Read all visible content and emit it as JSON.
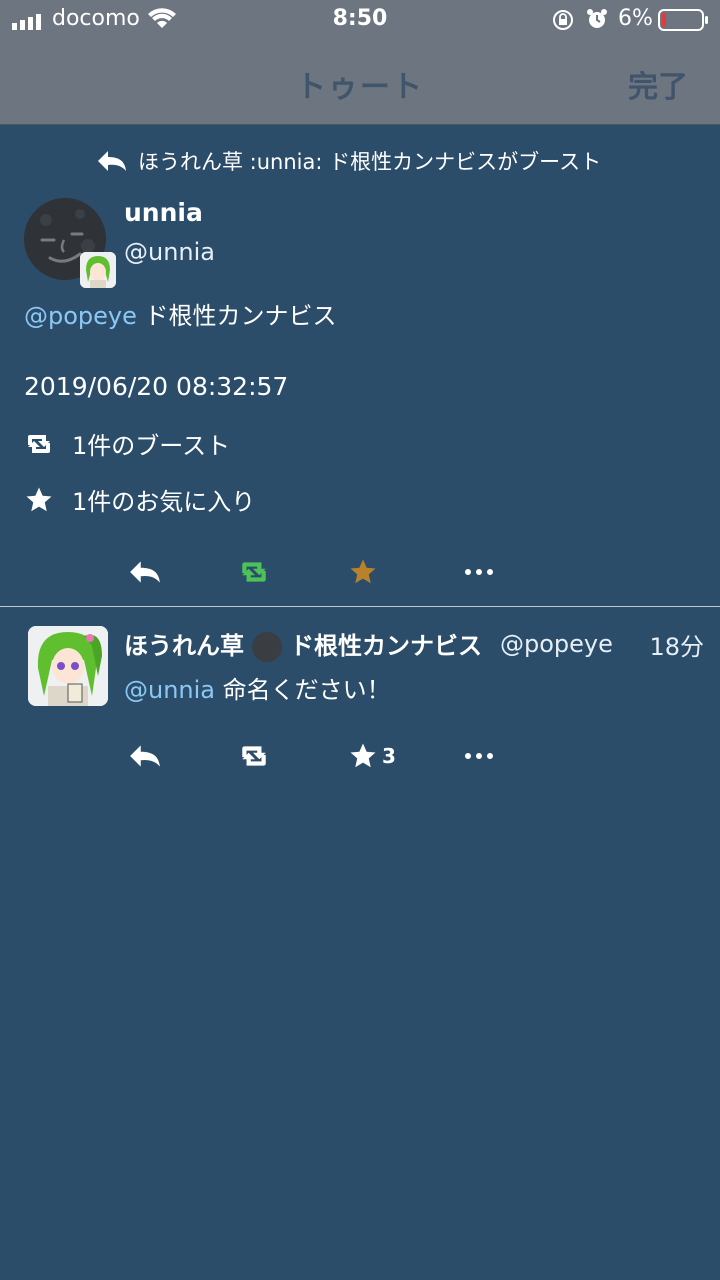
{
  "status_bar": {
    "carrier": "docomo",
    "time": "8:50",
    "battery": "6%"
  },
  "nav": {
    "title": "トゥート",
    "done": "完了"
  },
  "boost": {
    "text": "ほうれん草 :unnia: ド根性カンナビスがブースト"
  },
  "toot": {
    "name": "unnia",
    "handle": "@unnia",
    "mention": "@popeye",
    "text": " ド根性カンナビス",
    "date": "2019/06/20 08:32:57",
    "boost_count": "1件のブースト",
    "fav_count": "1件のお気に入り"
  },
  "reply": {
    "name_part1": "ほうれん草",
    "name_part2": "ド根性カンナビス",
    "handle": "@popeye",
    "time": "18分",
    "mention": "@unnia",
    "text": " 命名ください！",
    "fav_number": "3"
  },
  "colors": {
    "background": "#2b4d69",
    "boost_active": "#4cc35a",
    "fav_active": "#b8822a",
    "mention": "#8cc8f4"
  }
}
